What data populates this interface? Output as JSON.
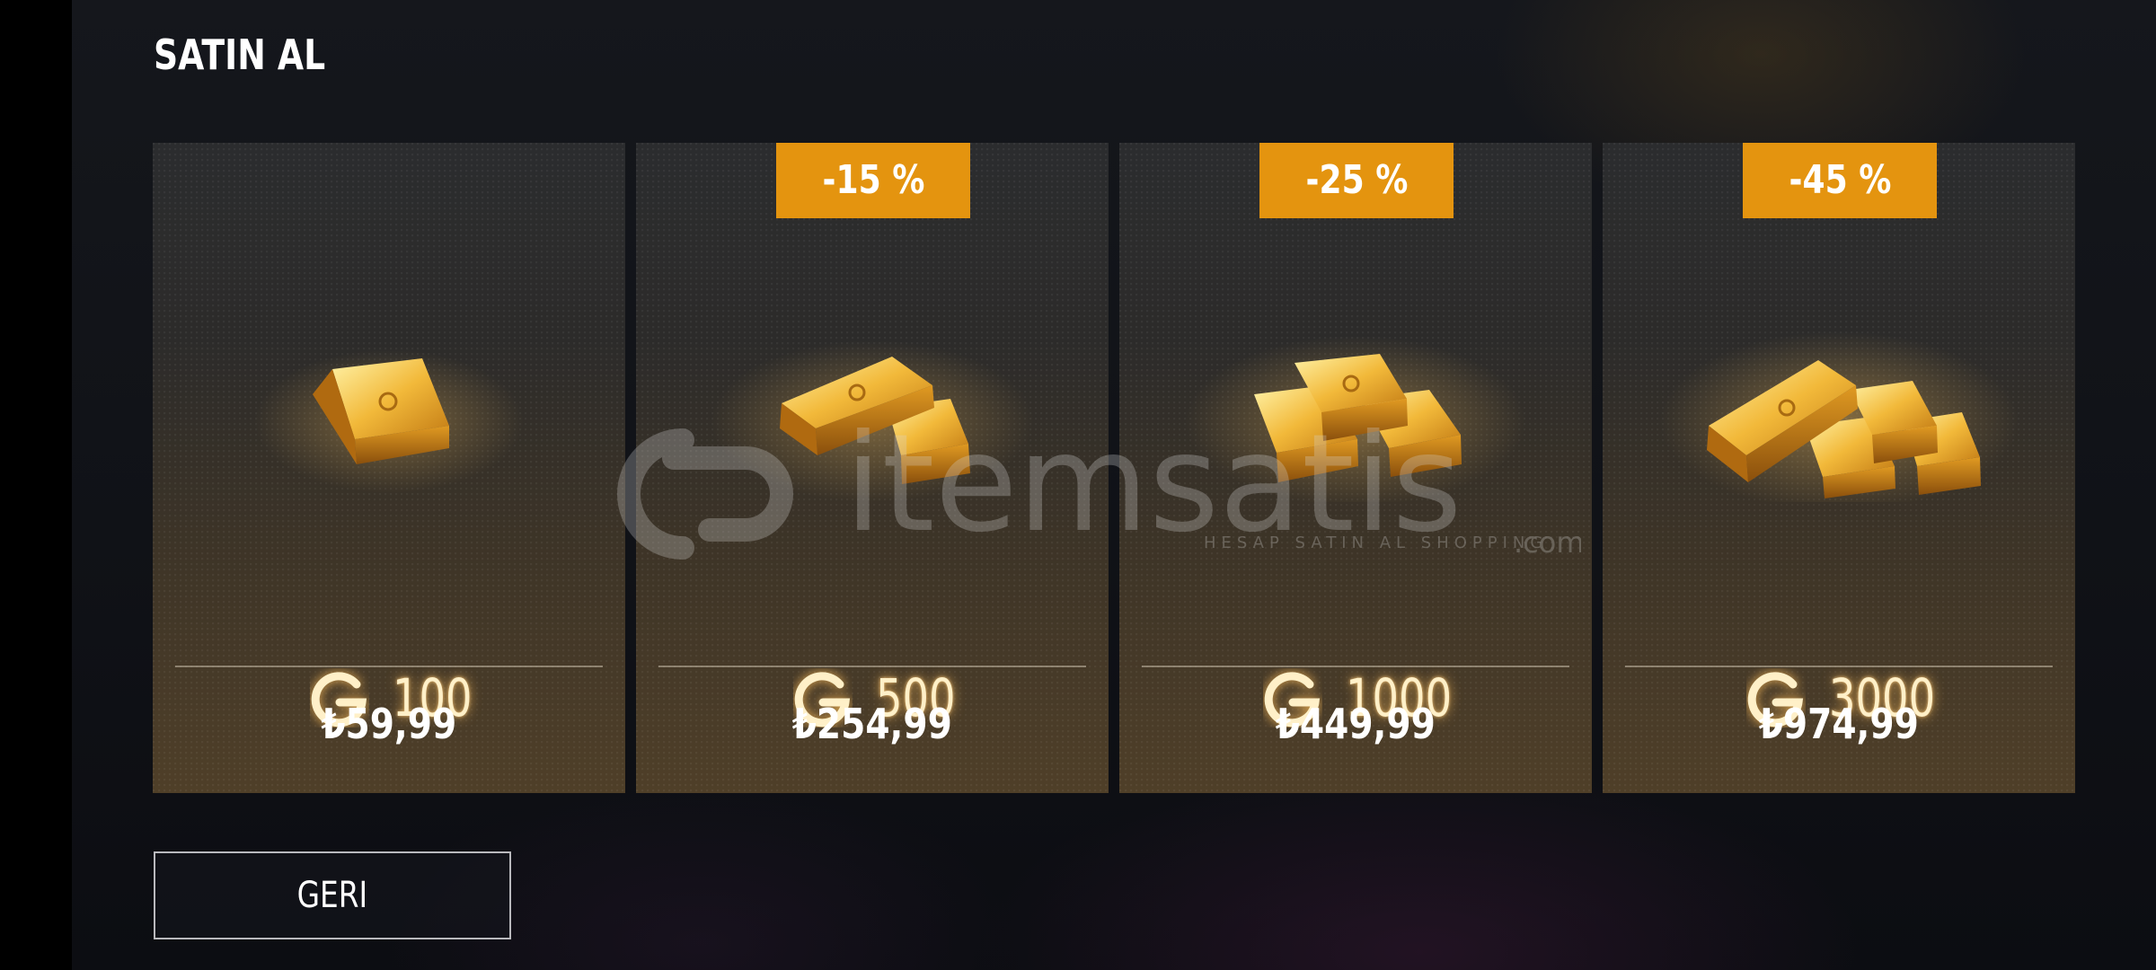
{
  "header": {
    "title": "SATIN AL"
  },
  "colors": {
    "badge": "#e4940f",
    "gold_text": "#fff0c8",
    "price_text": "#ffffff",
    "divider": "#c8beaa"
  },
  "offers": [
    {
      "discount": "",
      "currency_icon": "g-coin-icon",
      "amount": "100",
      "price": "₺59,99",
      "bars": 1
    },
    {
      "discount": "-15 %",
      "currency_icon": "g-coin-icon",
      "amount": "500",
      "price": "₺254,99",
      "bars": 2
    },
    {
      "discount": "-25 %",
      "currency_icon": "g-coin-icon",
      "amount": "1000",
      "price": "₺449,99",
      "bars": 3
    },
    {
      "discount": "-45 %",
      "currency_icon": "g-coin-icon",
      "amount": "3000",
      "price": "₺974,99",
      "bars": 4
    }
  ],
  "footer": {
    "back_label": "GERI"
  },
  "watermark": {
    "text": "itemsatis",
    "subtext": "HESAP SATIN AL SHOPPING",
    "domain": ".com"
  }
}
